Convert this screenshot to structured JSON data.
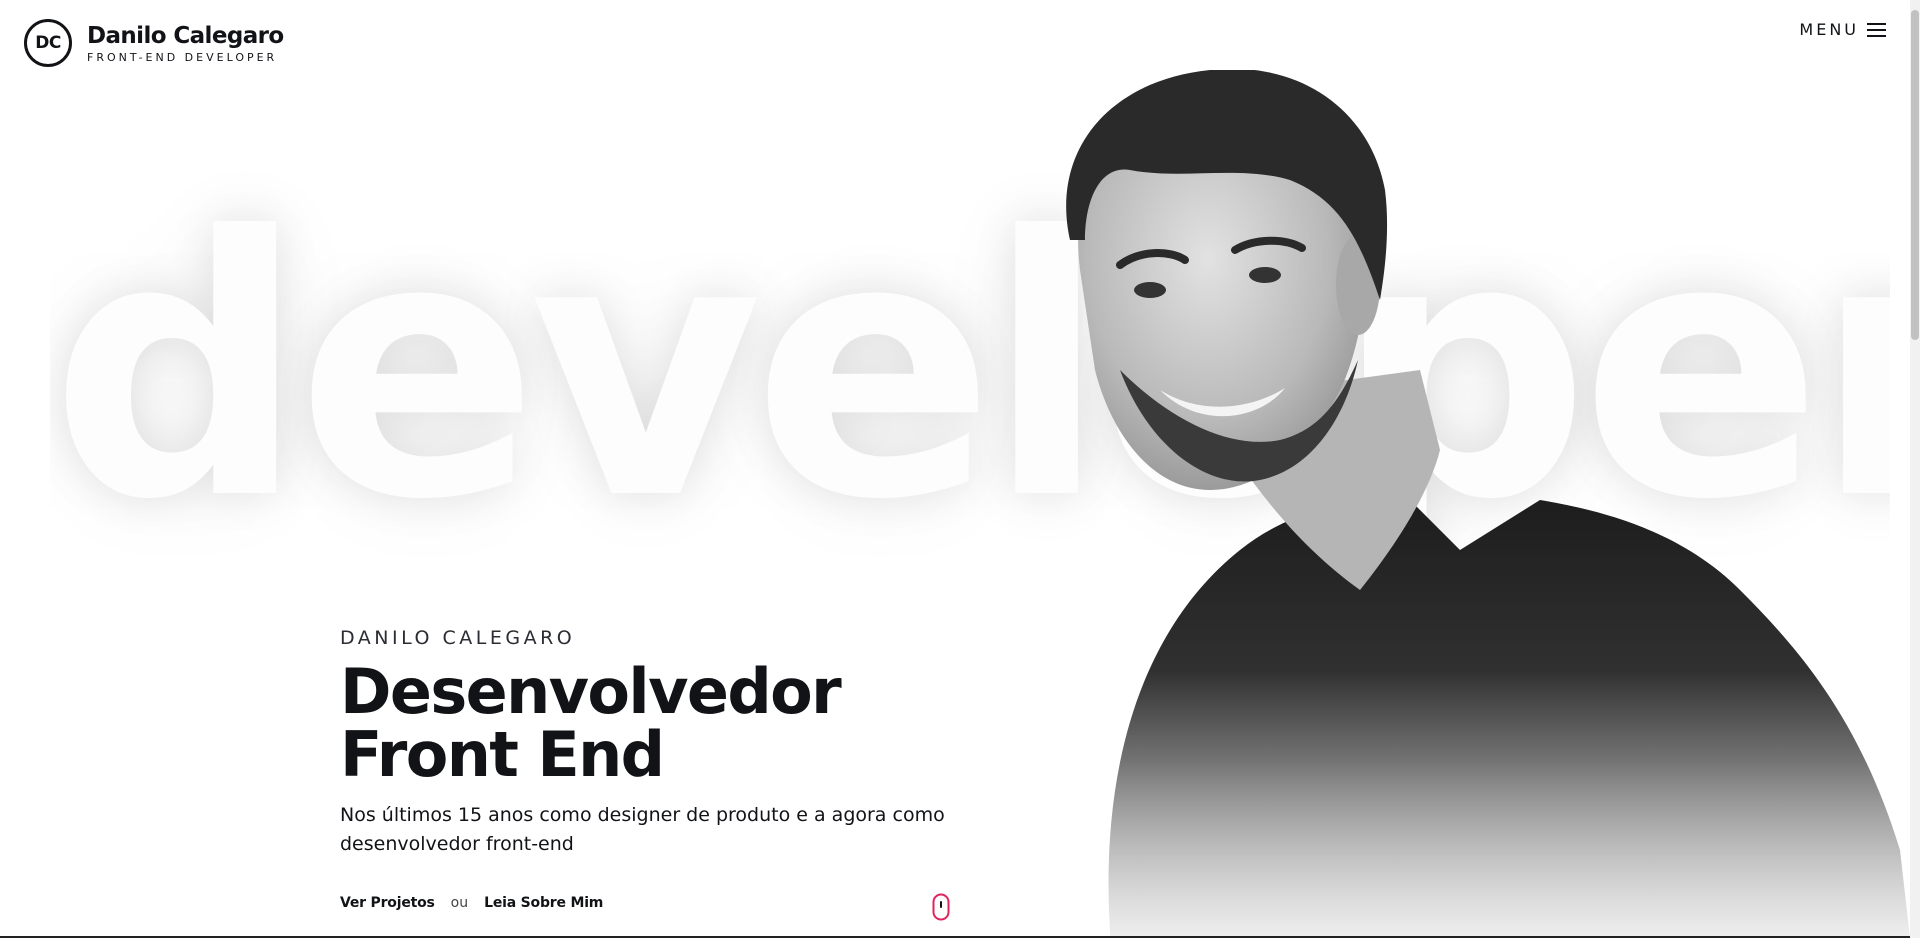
{
  "header": {
    "logo_initials": "DC",
    "name": "Danilo Calegaro",
    "role": "FRONT-END DEVELOPER",
    "menu_label": "MENU"
  },
  "background_word": "developer",
  "hero": {
    "eyebrow": "DANILO CALEGARO",
    "headline_line1": "Desenvolvedor",
    "headline_line2": "Front End",
    "description": "Nos últimos 15 anos como designer de produto e a agora como desenvolvedor front-end",
    "cta_projects": "Ver Projetos",
    "cta_or": "ou",
    "cta_about": "Leia Sobre Mim"
  },
  "icons": {
    "menu": "hamburger-icon",
    "scroll": "mouse-scroll-icon"
  },
  "colors": {
    "text": "#111317",
    "accent": "#e0245e",
    "background": "#ffffff"
  }
}
